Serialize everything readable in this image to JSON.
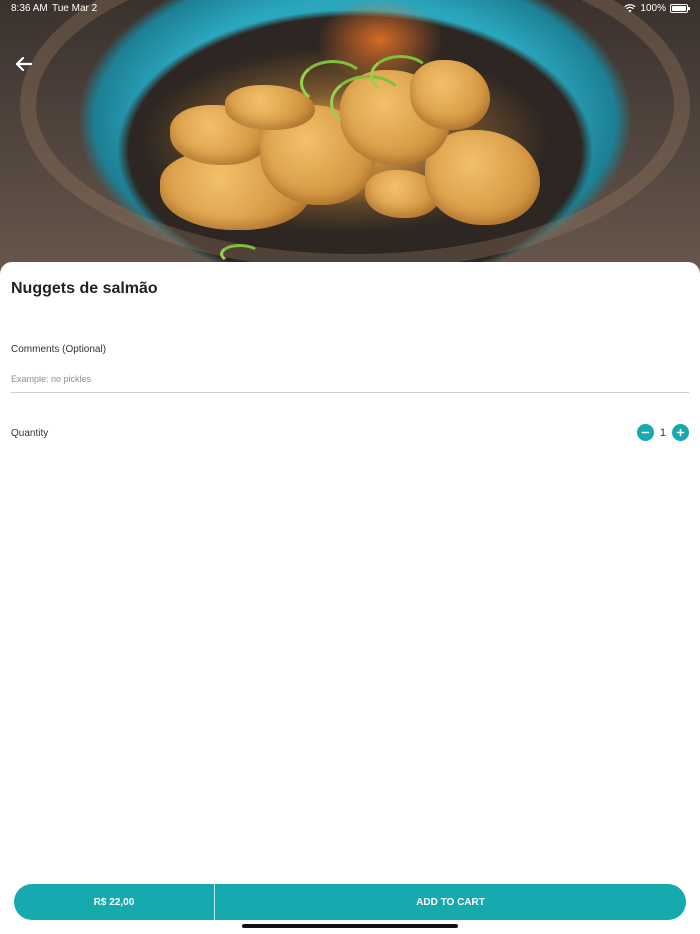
{
  "status_bar": {
    "time": "8:36 AM",
    "date": "Tue Mar 2",
    "battery": "100%"
  },
  "product": {
    "title": "Nuggets de salmão",
    "image_icon": "salmon-nuggets-photo"
  },
  "comments": {
    "label": "Comments (Optional)",
    "placeholder": "Example: no pickles",
    "value": ""
  },
  "quantity": {
    "label": "Quantity",
    "value": "1",
    "decrement_icon": "minus-icon",
    "increment_icon": "plus-icon"
  },
  "cart_bar": {
    "price": "R$ 22,00",
    "add_label": "ADD TO CART"
  },
  "colors": {
    "accent": "#16a9ae"
  }
}
